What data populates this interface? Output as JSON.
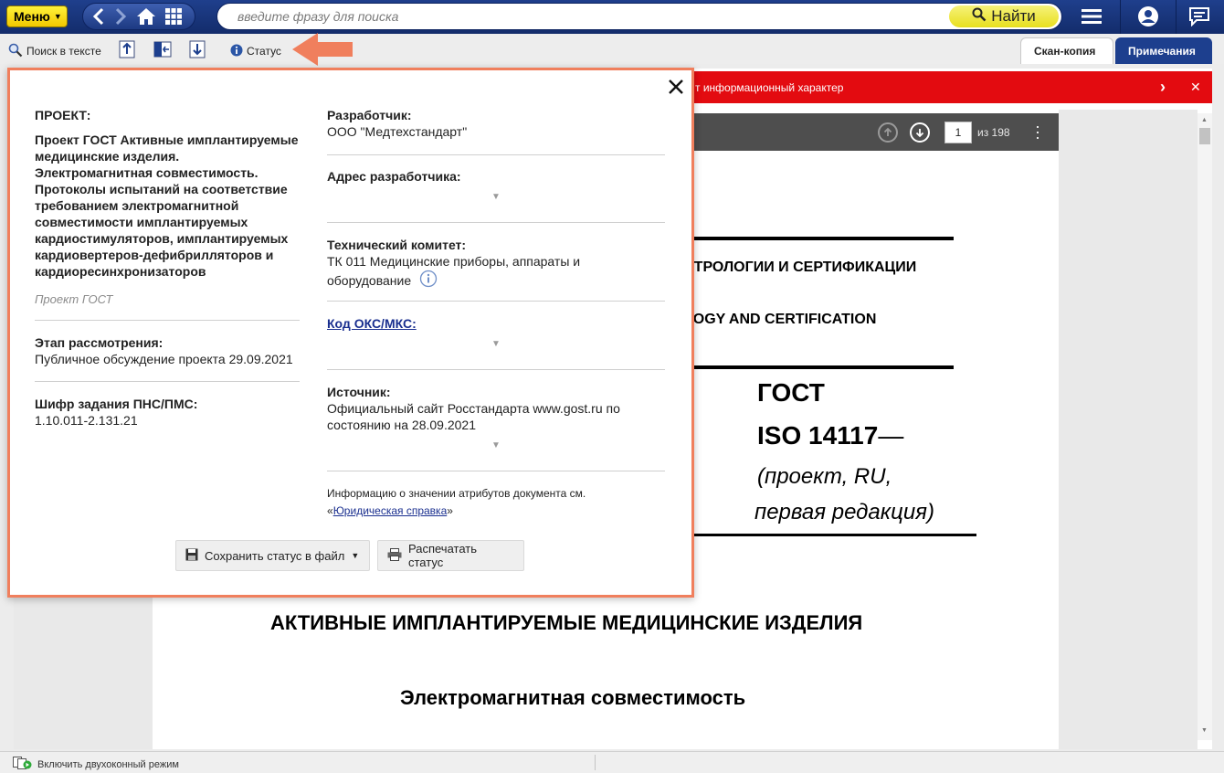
{
  "topbar": {
    "menu_label": "Меню",
    "search_placeholder": "введите фразу для поиска",
    "find_label": "Найти"
  },
  "toolbar": {
    "search_in_text": "Поиск в тексте",
    "status": "Статус"
  },
  "tabs": {
    "scan_copy": "Скан-копия",
    "notes": "Примечания"
  },
  "alert": {
    "message": "т информационный характер"
  },
  "viewer": {
    "page": "1",
    "page_total": "из 198"
  },
  "document": {
    "line_metrology": "ЕТРОЛОГИИ И СЕРТИФИКАЦИИ",
    "line_metrology_en": "LOGY AND CERTIFICATION",
    "gost": "ГОСТ",
    "iso": "ISO 14117",
    "iso_dash": "—",
    "draft": "(проект, RU,",
    "edition": "первая редакция)",
    "heading": "АКТИВНЫЕ ИМПЛАНТИРУЕМЫЕ МЕДИЦИНСКИЕ ИЗДЕЛИЯ",
    "subheading": "Электромагнитная совместимость"
  },
  "status_popup": {
    "project_label": "ПРОЕКТ:",
    "project_title_lines": [
      "Проект ГОСТ Активные имплантируемые",
      "медицинские изделия.",
      "Электромагнитная совместимость.",
      "Протоколы испытаний на соответствие",
      "требованием электромагнитной",
      "совместимости имплантируемых",
      "кардиостимуляторов, имплантируемых",
      "кардиовертеров-дефибрилляторов и",
      "кардиоресинхронизаторов"
    ],
    "project_type": "Проект ГОСТ",
    "stage_label": "Этап рассмотрения:",
    "stage_value": "Публичное обсуждение проекта 29.09.2021",
    "cipher_label": "Шифр задания ПНС/ПМС:",
    "cipher_value": "1.10.011-2.131.21",
    "developer_label": "Разработчик:",
    "developer_value": "ООО \"Медтехстандарт\"",
    "developer_address_label": "Адрес разработчика:",
    "committee_label": "Технический комитет:",
    "committee_line1": "ТК 011 Медицинские приборы, аппараты и",
    "committee_line2": "оборудование",
    "oks_label": "Код ОКС/МКС:",
    "source_label": "Источник:",
    "source_line1": "Официальный сайт Росстандарта www.gost.ru по",
    "source_line2": "состоянию на 28.09.2021",
    "info_prefix": "Информацию о значении атрибутов документа см.",
    "info_open_quote": "«",
    "info_link": "Юридическая справка",
    "info_close_quote": "»",
    "save_button": "Сохранить статус в файл",
    "print_button": "Распечатать статус"
  },
  "statusbar": {
    "dual_window": "Включить двухоконный режим"
  },
  "colors": {
    "nav_blue": "#1d3f8e",
    "accent_yellow": "#f2c800",
    "alert_red": "#e30b10",
    "popup_border": "#f07f5d"
  }
}
